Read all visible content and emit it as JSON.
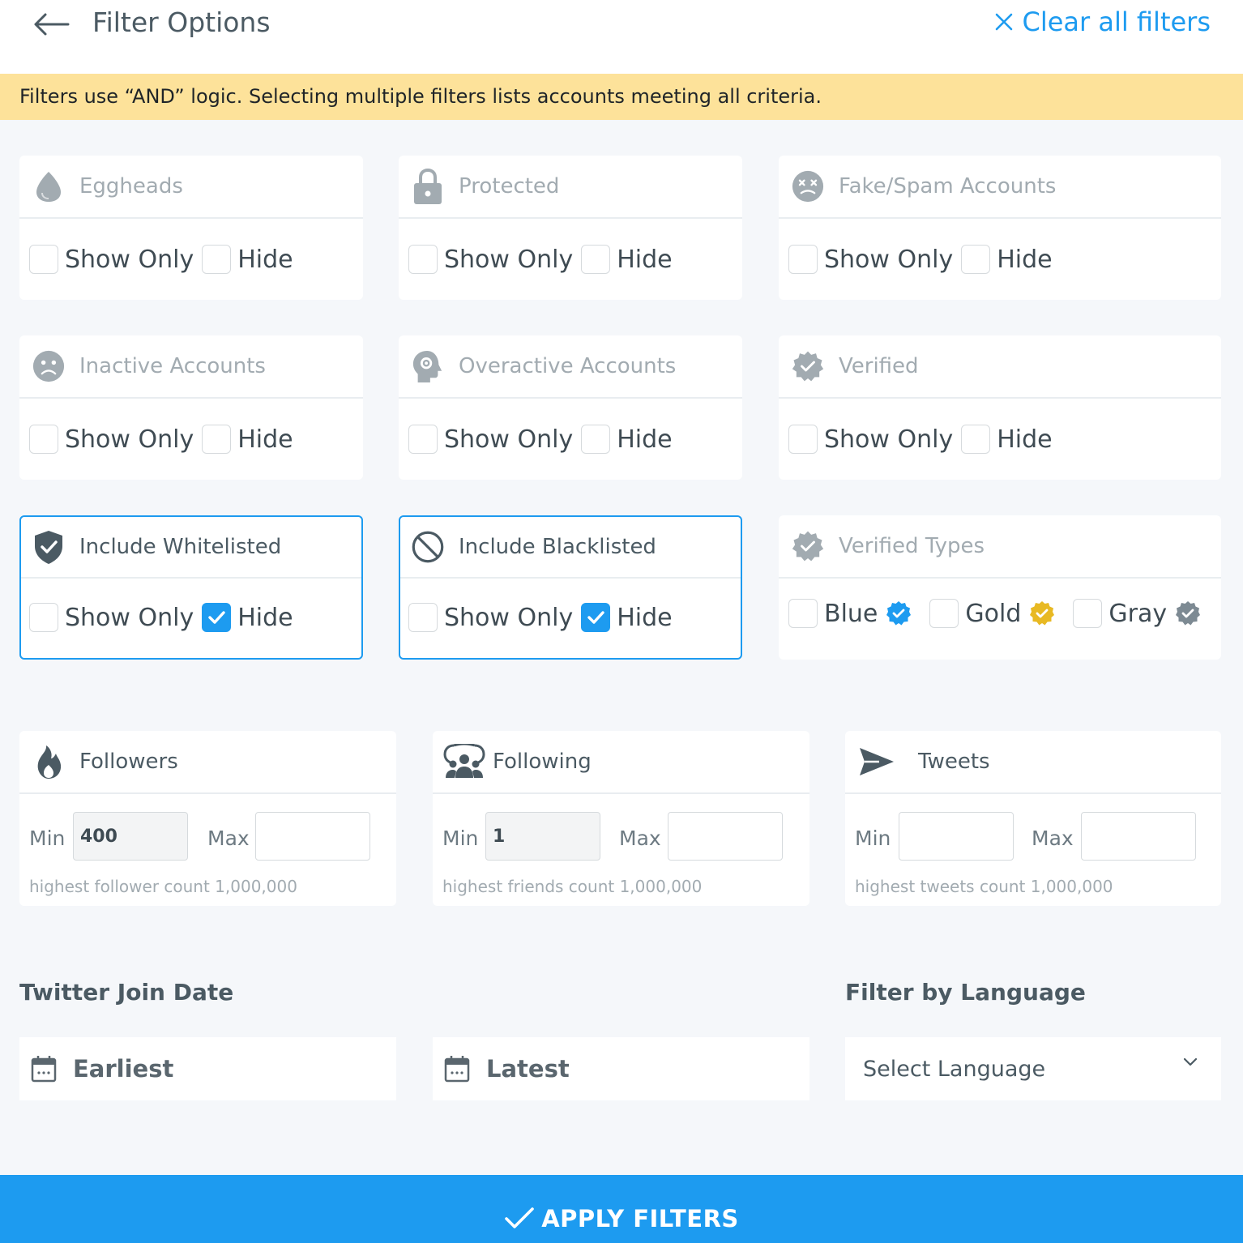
{
  "header": {
    "title": "Filter Options",
    "clear_label": "Clear all filters"
  },
  "notice": "Filters use “AND” logic. Selecting multiple filters lists accounts meeting all criteria.",
  "toggle_cards": [
    {
      "title": "Eggheads",
      "show_only": "Show Only",
      "hide": "Hide",
      "show_only_checked": false,
      "hide_checked": false
    },
    {
      "title": "Protected",
      "show_only": "Show Only",
      "hide": "Hide",
      "show_only_checked": false,
      "hide_checked": false
    },
    {
      "title": "Fake/Spam Accounts",
      "show_only": "Show Only",
      "hide": "Hide",
      "show_only_checked": false,
      "hide_checked": false
    },
    {
      "title": "Inactive Accounts",
      "show_only": "Show Only",
      "hide": "Hide",
      "show_only_checked": false,
      "hide_checked": false
    },
    {
      "title": "Overactive Accounts",
      "show_only": "Show Only",
      "hide": "Hide",
      "show_only_checked": false,
      "hide_checked": false
    },
    {
      "title": "Verified",
      "show_only": "Show Only",
      "hide": "Hide",
      "show_only_checked": false,
      "hide_checked": false
    },
    {
      "title": "Include Whitelisted",
      "show_only": "Show Only",
      "hide": "Hide",
      "show_only_checked": false,
      "hide_checked": true
    },
    {
      "title": "Include Blacklisted",
      "show_only": "Show Only",
      "hide": "Hide",
      "show_only_checked": false,
      "hide_checked": true
    }
  ],
  "verified_types": {
    "title": "Verified Types",
    "options": [
      {
        "label": "Blue",
        "color": "#1d9bf0"
      },
      {
        "label": "Gold",
        "color": "#e8b923"
      },
      {
        "label": "Gray",
        "color": "#7d8a93"
      }
    ]
  },
  "metrics": [
    {
      "title": "Followers",
      "min_label": "Min",
      "max_label": "Max",
      "min_value": "400",
      "max_value": "",
      "hint": "highest follower count 1,000,000"
    },
    {
      "title": "Following",
      "min_label": "Min",
      "max_label": "Max",
      "min_value": "1",
      "max_value": "",
      "hint": "highest friends count 1,000,000"
    },
    {
      "title": "Tweets",
      "min_label": "Min",
      "max_label": "Max",
      "min_value": "",
      "max_value": "",
      "hint": "highest tweets count 1,000,000"
    }
  ],
  "join_date": {
    "title": "Twitter Join Date",
    "earliest": "Earliest",
    "latest": "Latest"
  },
  "language": {
    "title": "Filter by Language",
    "placeholder": "Select Language"
  },
  "apply_label": "APPLY FILTERS",
  "colors": {
    "accent": "#1d9bf0",
    "notice_bg": "#fde29a",
    "icon_gray": "#a2abb1",
    "icon_dark": "#4b5a63"
  }
}
